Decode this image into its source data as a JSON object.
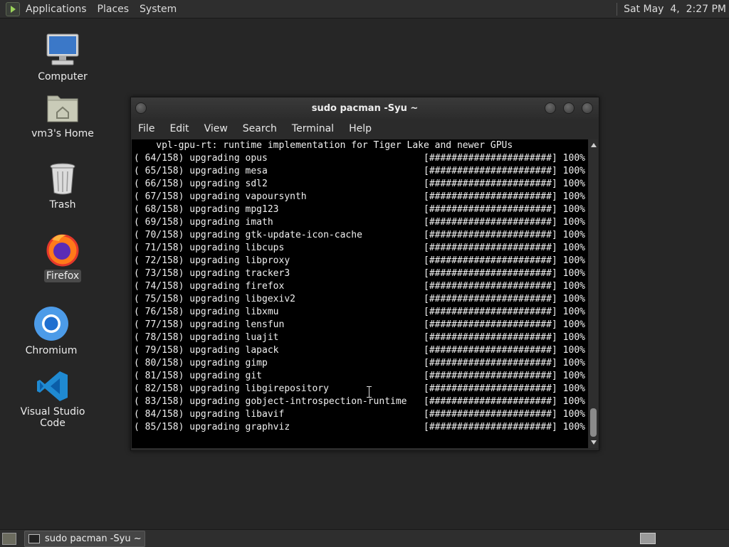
{
  "top_panel": {
    "menus": [
      "Applications",
      "Places",
      "System"
    ],
    "clock": "Sat May  4,  2:27 PM"
  },
  "desktop": {
    "icons": [
      {
        "label": "Computer",
        "icon": "computer-icon"
      },
      {
        "label": "vm3's Home",
        "icon": "home-folder-icon"
      },
      {
        "label": "Trash",
        "icon": "trash-icon"
      },
      {
        "label": "Firefox",
        "icon": "firefox-icon"
      },
      {
        "label": "Chromium",
        "icon": "chromium-icon"
      },
      {
        "label": "Visual Studio Code",
        "icon": "vscode-icon"
      }
    ]
  },
  "window": {
    "title": "sudo pacman -Syu ~",
    "menu": [
      "File",
      "Edit",
      "View",
      "Search",
      "Terminal",
      "Help"
    ],
    "terminal": {
      "first_line": "    vpl-gpu-rt: runtime implementation for Tiger Lake and newer GPUs",
      "lines": [
        {
          "text": "( 64/158) upgrading opus",
          "bar": "[######################] 100%"
        },
        {
          "text": "( 65/158) upgrading mesa",
          "bar": "[######################] 100%"
        },
        {
          "text": "( 66/158) upgrading sdl2",
          "bar": "[######################] 100%"
        },
        {
          "text": "( 67/158) upgrading vapoursynth",
          "bar": "[######################] 100%"
        },
        {
          "text": "( 68/158) upgrading mpg123",
          "bar": "[######################] 100%"
        },
        {
          "text": "( 69/158) upgrading imath",
          "bar": "[######################] 100%"
        },
        {
          "text": "( 70/158) upgrading gtk-update-icon-cache",
          "bar": "[######################] 100%"
        },
        {
          "text": "( 71/158) upgrading libcups",
          "bar": "[######################] 100%"
        },
        {
          "text": "( 72/158) upgrading libproxy",
          "bar": "[######################] 100%"
        },
        {
          "text": "( 73/158) upgrading tracker3",
          "bar": "[######################] 100%"
        },
        {
          "text": "( 74/158) upgrading firefox",
          "bar": "[######################] 100%"
        },
        {
          "text": "( 75/158) upgrading libgexiv2",
          "bar": "[######################] 100%"
        },
        {
          "text": "( 76/158) upgrading libxmu",
          "bar": "[######################] 100%"
        },
        {
          "text": "( 77/158) upgrading lensfun",
          "bar": "[######################] 100%"
        },
        {
          "text": "( 78/158) upgrading luajit",
          "bar": "[######################] 100%"
        },
        {
          "text": "( 79/158) upgrading lapack",
          "bar": "[######################] 100%"
        },
        {
          "text": "( 80/158) upgrading gimp",
          "bar": "[######################] 100%"
        },
        {
          "text": "( 81/158) upgrading git",
          "bar": "[######################] 100%"
        },
        {
          "text": "( 82/158) upgrading libgirepository",
          "bar": "[######################] 100%"
        },
        {
          "text": "( 83/158) upgrading gobject-introspection-runtime",
          "bar": "[######################] 100%"
        },
        {
          "text": "( 84/158) upgrading libavif",
          "bar": "[######################] 100%"
        },
        {
          "text": "( 85/158) upgrading graphviz",
          "bar": "[######################] 100%"
        }
      ]
    }
  },
  "taskbar": {
    "task_label": "sudo pacman -Syu ~"
  }
}
